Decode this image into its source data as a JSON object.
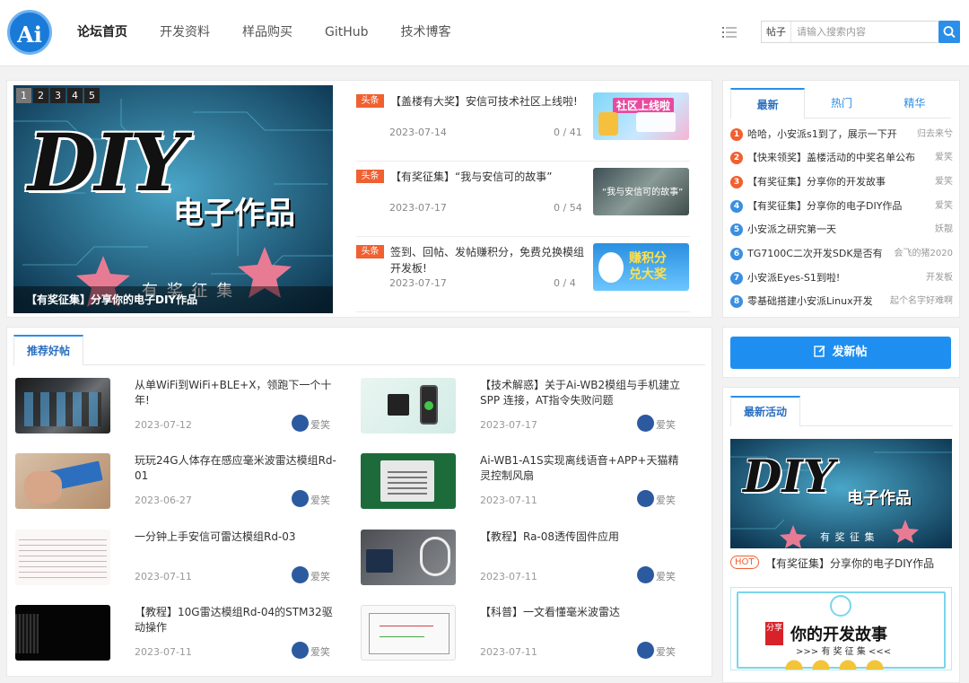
{
  "header": {
    "logo_text": "Ai",
    "nav": [
      "论坛首页",
      "开发资料",
      "样品购买",
      "GitHub",
      "技术博客"
    ],
    "search_type": "帖子",
    "search_placeholder": "请输入搜索内容"
  },
  "slider": {
    "pages": [
      "1",
      "2",
      "3",
      "4",
      "5"
    ],
    "active_page": "1",
    "image_big": "DIY",
    "image_text": "电子作品",
    "image_sub": "有 奖 征 集",
    "caption": "【有奖征集】分享你的电子DIY作品"
  },
  "headlines": [
    {
      "badge": "头条",
      "title": "【盖楼有大奖】安信可技术社区上线啦!",
      "date": "2023-07-14",
      "count": "0 / 41",
      "thumb_text": "社区上线啦"
    },
    {
      "badge": "头条",
      "title": "【有奖征集】“我与安信可的故事”",
      "date": "2023-07-17",
      "count": "0 / 54",
      "thumb_text": "“我与安信可的故事”"
    },
    {
      "badge": "头条",
      "title": "签到、回帖、发帖赚积分，免费兑换模组开发板!",
      "date": "2023-07-17",
      "count": "0 / 4",
      "thumb_text": "赚积分 兑大奖"
    }
  ],
  "side_tabs": [
    "最新",
    "热门",
    "精华"
  ],
  "latest": [
    {
      "num": "1",
      "title": "哈哈，小安派s1到了，展示一下开",
      "author": "归去来兮"
    },
    {
      "num": "2",
      "title": "【快来领奖】盖楼活动的中奖名单公布",
      "author": "爱笑"
    },
    {
      "num": "3",
      "title": "【有奖征集】分享你的开发故事",
      "author": "爱笑"
    },
    {
      "num": "4",
      "title": "【有奖征集】分享你的电子DIY作品",
      "author": "爱笑"
    },
    {
      "num": "5",
      "title": "小安派之研究第一天",
      "author": "妖靓"
    },
    {
      "num": "6",
      "title": "TG7100C二次开发SDK是否有",
      "author": "会飞的猪2020"
    },
    {
      "num": "7",
      "title": "小安派Eyes-S1到啦!",
      "author": "开发板"
    },
    {
      "num": "8",
      "title": "零基础搭建小安派Linux开发",
      "author": "起个名字好难啊"
    }
  ],
  "colors": {
    "accent": "#2b8ee8",
    "badge": "#f06030",
    "num_top": "#f06030",
    "num_rest": "#3a8fe0"
  },
  "recommend": {
    "tab": "推荐好帖",
    "posts": [
      {
        "title": "从单WiFi到WiFi+BLE+X，领跑下一个十年!",
        "date": "2023-07-12",
        "author": "爱笑"
      },
      {
        "title": "【技术解惑】关于Ai-WB2模组与手机建立SPP 连接，AT指令失败问题",
        "date": "2023-07-17",
        "author": "爱笑"
      },
      {
        "title": "玩玩24G人体存在感应毫米波雷达模组Rd-01",
        "date": "2023-06-27",
        "author": "爱笑"
      },
      {
        "title": "Ai-WB1-A1S实现离线语音+APP+天猫精灵控制风扇",
        "date": "2023-07-11",
        "author": "爱笑"
      },
      {
        "title": "一分钟上手安信可雷达模组Rd-03",
        "date": "2023-07-11",
        "author": "爱笑"
      },
      {
        "title": "【教程】Ra-08透传固件应用",
        "date": "2023-07-11",
        "author": "爱笑"
      },
      {
        "title": "【教程】10G雷达模组Rd-04的STM32驱动操作",
        "date": "2023-07-11",
        "author": "爱笑"
      },
      {
        "title": "【科普】一文看懂毫米波雷达",
        "date": "2023-07-11",
        "author": "爱笑"
      }
    ]
  },
  "new_post_button": "发新帖",
  "activity": {
    "tab": "最新活动",
    "image_big": "DIY",
    "image_text": "电子作品",
    "image_sub": "有 奖 征 集",
    "hot_badge": "HOT",
    "title": "【有奖征集】分享你的电子DIY作品",
    "image2_badge": "分享",
    "image2_title": "你的开发故事",
    "image2_sub": ">>> 有 奖 征 集 <<<"
  }
}
